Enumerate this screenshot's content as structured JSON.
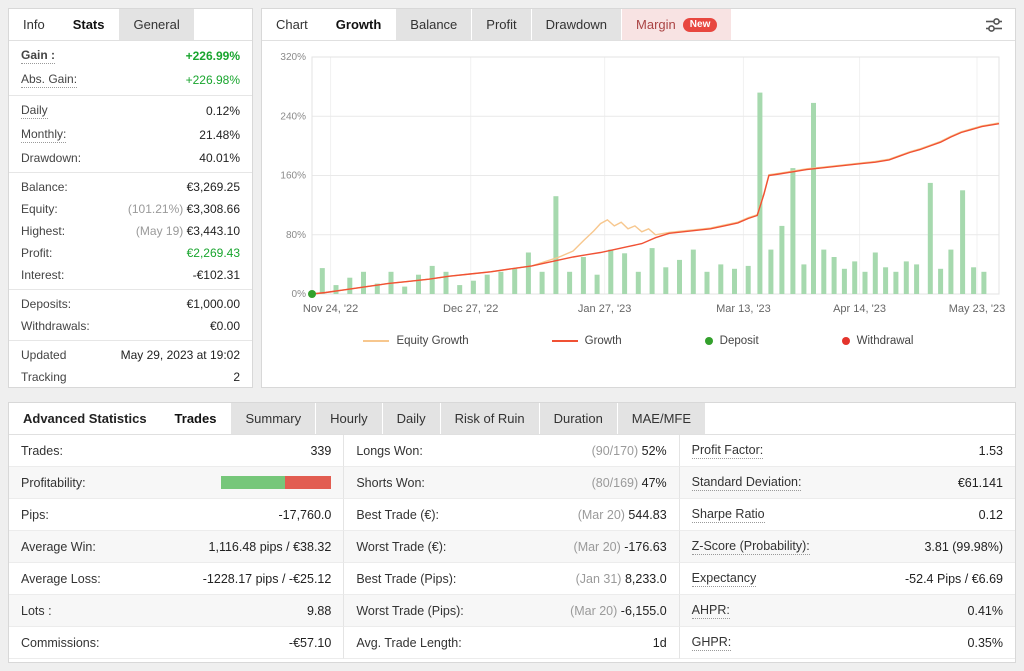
{
  "colors": {
    "green": "#19a52e",
    "growth_line": "#f05134",
    "equity_line": "#f7c78e",
    "bar_fill": "#a6d9ae",
    "deposit_dot": "#33a02c",
    "withdrawal_dot": "#e4342c",
    "profitability_green": "#76c77a",
    "profitability_red": "#e25d51"
  },
  "left_panel": {
    "tabs": [
      {
        "label": "Info",
        "style": "plain"
      },
      {
        "label": "Stats",
        "style": "active"
      },
      {
        "label": "General",
        "style": "chip"
      }
    ],
    "groups": [
      {
        "rows": [
          {
            "label": "Gain :",
            "value": "+226.99%",
            "bold": true,
            "dashed": true,
            "value_color": "green"
          },
          {
            "label": "Abs. Gain:",
            "value": "+226.98%",
            "dashed": true,
            "value_color": "green"
          }
        ]
      },
      {
        "rows": [
          {
            "label": "Daily",
            "value": "0.12%",
            "dashed": true
          },
          {
            "label": "Monthly:",
            "value": "21.48%",
            "dashed": true
          },
          {
            "label": "Drawdown:",
            "value": "40.01%"
          }
        ]
      },
      {
        "rows": [
          {
            "label": "Balance:",
            "value": "€3,269.25"
          },
          {
            "label": "Equity:",
            "prefix": "(101.21%)",
            "value": "€3,308.66"
          },
          {
            "label": "Highest:",
            "prefix": "(May 19)",
            "value": "€3,443.10"
          },
          {
            "label": "Profit:",
            "value": "€2,269.43",
            "value_color": "green"
          },
          {
            "label": "Interest:",
            "value": "-€102.31"
          }
        ]
      },
      {
        "rows": [
          {
            "label": "Deposits:",
            "value": "€1,000.00"
          },
          {
            "label": "Withdrawals:",
            "value": "€0.00"
          }
        ]
      },
      {
        "rows": [
          {
            "label": "Updated",
            "value": "May 29, 2023 at 19:02"
          },
          {
            "label": "Tracking",
            "value": "2"
          }
        ]
      }
    ]
  },
  "chart_panel": {
    "tabs": [
      {
        "label": "Chart",
        "style": "plain"
      },
      {
        "label": "Growth",
        "style": "active"
      },
      {
        "label": "Balance",
        "style": "chip"
      },
      {
        "label": "Profit",
        "style": "chip"
      },
      {
        "label": "Drawdown",
        "style": "chip"
      },
      {
        "label": "Margin",
        "style": "chip-margin",
        "badge": "New"
      }
    ]
  },
  "chart_data": {
    "type": "line+bar",
    "title": "Growth",
    "ylim": [
      0,
      320
    ],
    "yticks": [
      0,
      80,
      160,
      240,
      320
    ],
    "ytick_labels": [
      "0%",
      "80%",
      "160%",
      "240%",
      "320%"
    ],
    "xtick_labels": [
      "Nov 24, '22",
      "Dec 27, '22",
      "Jan 27, '23",
      "Mar 13, '23",
      "Apr 14, '23",
      "May 23, '23"
    ],
    "xtick_pos": [
      0.027,
      0.231,
      0.426,
      0.628,
      0.797,
      0.968
    ],
    "series": [
      {
        "name": "Equity Growth",
        "color_key": "equity_line",
        "points": [
          [
            0,
            0
          ],
          [
            0.02,
            2
          ],
          [
            0.05,
            6
          ],
          [
            0.08,
            10
          ],
          [
            0.11,
            14
          ],
          [
            0.14,
            17
          ],
          [
            0.17,
            20
          ],
          [
            0.2,
            24
          ],
          [
            0.23,
            27
          ],
          [
            0.26,
            30
          ],
          [
            0.29,
            34
          ],
          [
            0.32,
            38
          ],
          [
            0.34,
            44
          ],
          [
            0.36,
            50
          ],
          [
            0.38,
            58
          ],
          [
            0.395,
            72
          ],
          [
            0.41,
            85
          ],
          [
            0.42,
            95
          ],
          [
            0.43,
            100
          ],
          [
            0.44,
            92
          ],
          [
            0.45,
            97
          ],
          [
            0.46,
            88
          ],
          [
            0.47,
            92
          ],
          [
            0.48,
            84
          ],
          [
            0.49,
            88
          ],
          [
            0.5,
            80
          ],
          [
            0.52,
            83
          ],
          [
            0.54,
            85
          ],
          [
            0.56,
            87
          ],
          [
            0.58,
            89
          ],
          [
            0.6,
            93
          ],
          [
            0.62,
            97
          ],
          [
            0.635,
            103
          ],
          [
            0.648,
            107
          ],
          [
            0.658,
            136
          ],
          [
            0.665,
            161
          ],
          [
            0.68,
            163
          ],
          [
            0.7,
            166
          ],
          [
            0.72,
            169
          ],
          [
            0.74,
            171
          ],
          [
            0.76,
            173
          ],
          [
            0.78,
            175
          ],
          [
            0.8,
            177
          ],
          [
            0.82,
            179
          ],
          [
            0.84,
            182
          ],
          [
            0.855,
            187
          ],
          [
            0.87,
            192
          ],
          [
            0.885,
            196
          ],
          [
            0.9,
            201
          ],
          [
            0.915,
            206
          ],
          [
            0.93,
            213
          ],
          [
            0.945,
            219
          ],
          [
            0.96,
            223
          ],
          [
            0.975,
            227
          ],
          [
            1,
            231
          ]
        ]
      },
      {
        "name": "Growth",
        "color_key": "growth_line",
        "points": [
          [
            0,
            0
          ],
          [
            0.02,
            2
          ],
          [
            0.05,
            6
          ],
          [
            0.08,
            10
          ],
          [
            0.11,
            14
          ],
          [
            0.14,
            17
          ],
          [
            0.17,
            20
          ],
          [
            0.2,
            24
          ],
          [
            0.23,
            27
          ],
          [
            0.26,
            30
          ],
          [
            0.29,
            34
          ],
          [
            0.32,
            38
          ],
          [
            0.34,
            42
          ],
          [
            0.36,
            46
          ],
          [
            0.38,
            50
          ],
          [
            0.4,
            53
          ],
          [
            0.42,
            56
          ],
          [
            0.44,
            60
          ],
          [
            0.46,
            64
          ],
          [
            0.48,
            68
          ],
          [
            0.5,
            76
          ],
          [
            0.52,
            82
          ],
          [
            0.54,
            84
          ],
          [
            0.56,
            86
          ],
          [
            0.58,
            88
          ],
          [
            0.6,
            92
          ],
          [
            0.62,
            96
          ],
          [
            0.635,
            102
          ],
          [
            0.648,
            106
          ],
          [
            0.658,
            135
          ],
          [
            0.665,
            160
          ],
          [
            0.68,
            162
          ],
          [
            0.7,
            165
          ],
          [
            0.72,
            168
          ],
          [
            0.74,
            170
          ],
          [
            0.76,
            172
          ],
          [
            0.78,
            174
          ],
          [
            0.8,
            176
          ],
          [
            0.82,
            178
          ],
          [
            0.84,
            181
          ],
          [
            0.855,
            186
          ],
          [
            0.87,
            191
          ],
          [
            0.885,
            195
          ],
          [
            0.9,
            200
          ],
          [
            0.915,
            205
          ],
          [
            0.93,
            212
          ],
          [
            0.945,
            218
          ],
          [
            0.96,
            222
          ],
          [
            0.975,
            226
          ],
          [
            1,
            230
          ]
        ]
      }
    ],
    "bars": {
      "points": [
        [
          0.015,
          35
        ],
        [
          0.035,
          12
        ],
        [
          0.055,
          22
        ],
        [
          0.075,
          30
        ],
        [
          0.095,
          14
        ],
        [
          0.115,
          30
        ],
        [
          0.135,
          10
        ],
        [
          0.155,
          26
        ],
        [
          0.175,
          38
        ],
        [
          0.195,
          30
        ],
        [
          0.215,
          12
        ],
        [
          0.235,
          18
        ],
        [
          0.255,
          26
        ],
        [
          0.275,
          30
        ],
        [
          0.295,
          34
        ],
        [
          0.315,
          56
        ],
        [
          0.335,
          30
        ],
        [
          0.355,
          132
        ],
        [
          0.375,
          30
        ],
        [
          0.395,
          50
        ],
        [
          0.415,
          26
        ],
        [
          0.435,
          60
        ],
        [
          0.455,
          55
        ],
        [
          0.475,
          30
        ],
        [
          0.495,
          62
        ],
        [
          0.515,
          36
        ],
        [
          0.535,
          46
        ],
        [
          0.555,
          60
        ],
        [
          0.575,
          30
        ],
        [
          0.595,
          40
        ],
        [
          0.615,
          34
        ],
        [
          0.635,
          38
        ],
        [
          0.652,
          272
        ],
        [
          0.668,
          60
        ],
        [
          0.684,
          92
        ],
        [
          0.7,
          170
        ],
        [
          0.716,
          40
        ],
        [
          0.73,
          258
        ],
        [
          0.745,
          60
        ],
        [
          0.76,
          50
        ],
        [
          0.775,
          34
        ],
        [
          0.79,
          44
        ],
        [
          0.805,
          30
        ],
        [
          0.82,
          56
        ],
        [
          0.835,
          36
        ],
        [
          0.85,
          30
        ],
        [
          0.865,
          44
        ],
        [
          0.88,
          40
        ],
        [
          0.9,
          150
        ],
        [
          0.915,
          34
        ],
        [
          0.93,
          60
        ],
        [
          0.947,
          140
        ],
        [
          0.963,
          36
        ],
        [
          0.978,
          30
        ]
      ]
    },
    "markers": [
      {
        "type": "deposit",
        "x": 0,
        "value": 0
      }
    ],
    "legend": [
      {
        "label": "Equity Growth",
        "swatch": "line",
        "color_key": "equity_line"
      },
      {
        "label": "Growth",
        "swatch": "line",
        "color_key": "growth_line"
      },
      {
        "label": "Deposit",
        "swatch": "dot",
        "color_key": "deposit_dot"
      },
      {
        "label": "Withdrawal",
        "swatch": "dot",
        "color_key": "withdrawal_dot"
      }
    ]
  },
  "stats_panel": {
    "tabs": [
      {
        "label": "Advanced Statistics",
        "style": "plain-bold"
      },
      {
        "label": "Trades",
        "style": "active"
      },
      {
        "label": "Summary",
        "style": "chip"
      },
      {
        "label": "Hourly",
        "style": "chip"
      },
      {
        "label": "Daily",
        "style": "chip"
      },
      {
        "label": "Risk of Ruin",
        "style": "chip"
      },
      {
        "label": "Duration",
        "style": "chip"
      },
      {
        "label": "MAE/MFE",
        "style": "chip"
      }
    ],
    "columns": [
      [
        {
          "label": "Trades:",
          "value": "339"
        },
        {
          "label": "Profitability:",
          "bar": {
            "green_pct": 58,
            "red_pct": 42
          }
        },
        {
          "label": "Pips:",
          "value": "-17,760.0"
        },
        {
          "label": "Average Win:",
          "value": "1,116.48 pips / €38.32"
        },
        {
          "label": "Average Loss:",
          "value": "-1228.17 pips / -€25.12"
        },
        {
          "label": "Lots :",
          "value": "9.88"
        },
        {
          "label": "Commissions:",
          "value": "-€57.10"
        }
      ],
      [
        {
          "label": "Longs Won:",
          "prefix": "(90/170)",
          "value": "52%"
        },
        {
          "label": "Shorts Won:",
          "prefix": "(80/169)",
          "value": "47%"
        },
        {
          "label": "Best Trade (€):",
          "prefix": "(Mar 20)",
          "value": "544.83"
        },
        {
          "label": "Worst Trade (€):",
          "prefix": "(Mar 20)",
          "value": "-176.63"
        },
        {
          "label": "Best Trade (Pips):",
          "prefix": "(Jan 31)",
          "value": "8,233.0"
        },
        {
          "label": "Worst Trade (Pips):",
          "prefix": "(Mar 20)",
          "value": "-6,155.0"
        },
        {
          "label": "Avg. Trade Length:",
          "value": "1d"
        }
      ],
      [
        {
          "label": "Profit Factor:",
          "value": "1.53",
          "dashed": true
        },
        {
          "label": "Standard Deviation:",
          "value": "€61.141",
          "dashed": true
        },
        {
          "label": "Sharpe Ratio",
          "value": "0.12",
          "dashed": true
        },
        {
          "label": "Z-Score (Probability):",
          "value": "3.81 (99.98%)",
          "dashed": true
        },
        {
          "label": "Expectancy",
          "value": "-52.4 Pips / €6.69",
          "dashed": true
        },
        {
          "label": "AHPR:",
          "value": "0.41%",
          "dashed": true
        },
        {
          "label": "GHPR:",
          "value": "0.35%",
          "dashed": true
        }
      ]
    ]
  }
}
